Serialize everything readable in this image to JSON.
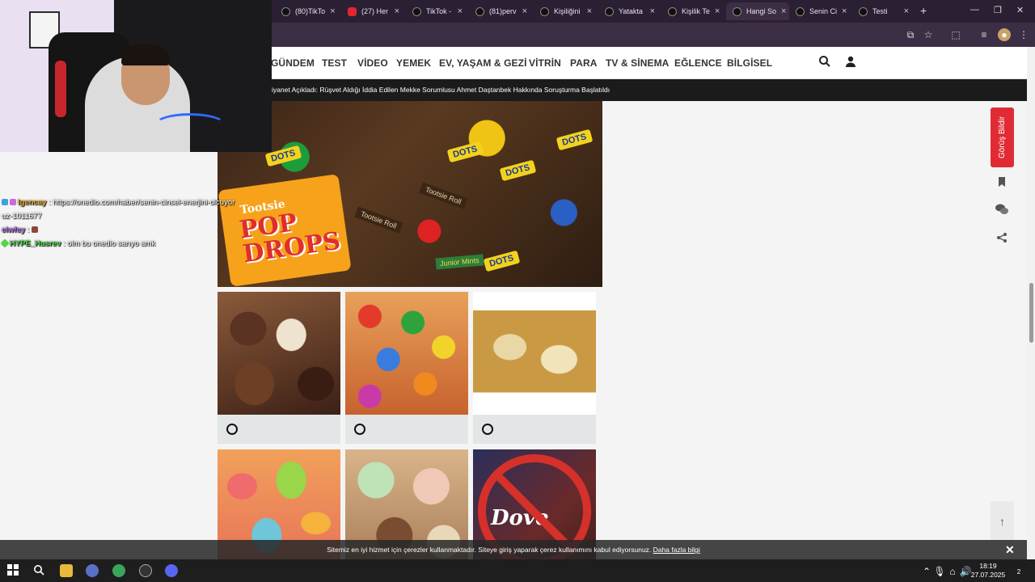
{
  "browser": {
    "tabs": [
      {
        "title": "(80)TikTo"
      },
      {
        "title": "(27) Her"
      },
      {
        "title": "TikTok -"
      },
      {
        "title": "(81)perv"
      },
      {
        "title": "Kişiliğini"
      },
      {
        "title": "Yatakta"
      },
      {
        "title": "Kişilik Te"
      },
      {
        "title": "Hangi So"
      },
      {
        "title": "Senin Ci"
      },
      {
        "title": "Testi"
      }
    ],
    "new_tab": "+",
    "window_controls": [
      "—",
      "❐",
      "✕"
    ]
  },
  "site": {
    "nav": [
      "GÜNDEM",
      "TEST",
      "VİDEO",
      "YEMEK",
      "EV, YAŞAM & GEZİ",
      "VİTRİN",
      "PARA",
      "TV & SİNEMA",
      "EĞLENCE",
      "BİLGİSEL"
    ],
    "ticker": "iyanet Açıkladı: Rüşvet Aldığı İddia Edilen Mekke Sorumlusu Ahmet Daştanbek Hakkında Soruşturma Başlatıldı"
  },
  "hero": {
    "pop_line1": "Tootsie",
    "pop_line2": "POP\nDROPS",
    "labels": [
      "DOTS",
      "DOTS",
      "DOTS",
      "DOTS",
      "DOTS",
      "Tootsie Roll",
      "Tootsie Roll",
      "Junior Mints"
    ]
  },
  "options_row3": {
    "dove": "Dove"
  },
  "side": {
    "feedback": "Görüş Bildir",
    "icons": [
      "bookmark-icon",
      "comments-icon",
      "share-icon"
    ],
    "to_top": "↑"
  },
  "cookie": {
    "text": "Sitemiz en iyi hizmet için çerezler kullanmaktadır. Siteye giriş yaparak çerez kullanımını kabul ediyorsunuz.",
    "link": "Daha fazla bilgi"
  },
  "taskbar": {
    "time": "18:19",
    "date": "27.07.2025",
    "notif": "2"
  },
  "chat": [
    {
      "user": "lgencay",
      "sep": " : ",
      "msg": "https://onedio.com/haber/senin-cinsel-enerjini-olcuyoruz-1011677"
    },
    {
      "user": "elwfey",
      "sep": " : ",
      "msg": ""
    },
    {
      "user": "HYPE_Husrev",
      "sep": " : ",
      "msg": "olm bu onedio sarıyo amk"
    }
  ],
  "colors": {
    "accent_red": "#e02b35",
    "browser_frame": "#2b1f33"
  }
}
